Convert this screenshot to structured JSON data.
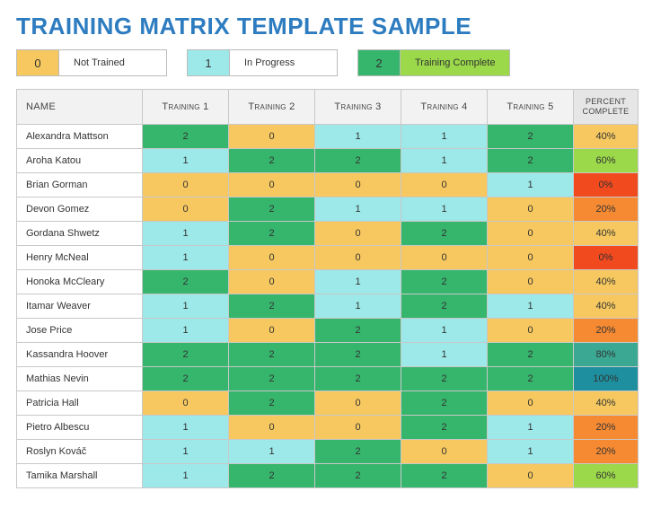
{
  "title": "TRAINING MATRIX TEMPLATE SAMPLE",
  "legend": [
    {
      "code": "0",
      "label": "Not Trained"
    },
    {
      "code": "1",
      "label": "In Progress"
    },
    {
      "code": "2",
      "label": "Training Complete"
    }
  ],
  "headers": {
    "name": "NAME",
    "trainings": [
      "Training 1",
      "Training 2",
      "Training 3",
      "Training 4",
      "Training 5"
    ],
    "percent": "PERCENT COMPLETE"
  },
  "percent_colors": {
    "0": "#f24a1f",
    "20": "#f58a33",
    "40": "#f6c85f",
    "60": "#9bd94a",
    "80": "#3aa893",
    "100": "#1d8f9e"
  },
  "rows": [
    {
      "name": "Alexandra Mattson",
      "t": [
        2,
        0,
        1,
        1,
        2
      ],
      "pct": "40%"
    },
    {
      "name": "Aroha Katou",
      "t": [
        1,
        2,
        2,
        1,
        2
      ],
      "pct": "60%"
    },
    {
      "name": "Brian Gorman",
      "t": [
        0,
        0,
        0,
        0,
        1
      ],
      "pct": "0%"
    },
    {
      "name": "Devon Gomez",
      "t": [
        0,
        2,
        1,
        1,
        0
      ],
      "pct": "20%"
    },
    {
      "name": "Gordana Shwetz",
      "t": [
        1,
        2,
        0,
        2,
        0
      ],
      "pct": "40%"
    },
    {
      "name": "Henry McNeal",
      "t": [
        1,
        0,
        0,
        0,
        0
      ],
      "pct": "0%"
    },
    {
      "name": "Honoka McCleary",
      "t": [
        2,
        0,
        1,
        2,
        0
      ],
      "pct": "40%"
    },
    {
      "name": "Itamar Weaver",
      "t": [
        1,
        2,
        1,
        2,
        1
      ],
      "pct": "40%"
    },
    {
      "name": "Jose Price",
      "t": [
        1,
        0,
        2,
        1,
        0
      ],
      "pct": "20%"
    },
    {
      "name": "Kassandra Hoover",
      "t": [
        2,
        2,
        2,
        1,
        2
      ],
      "pct": "80%"
    },
    {
      "name": "Mathias Nevin",
      "t": [
        2,
        2,
        2,
        2,
        2
      ],
      "pct": "100%"
    },
    {
      "name": "Patricia Hall",
      "t": [
        0,
        2,
        0,
        2,
        0
      ],
      "pct": "40%"
    },
    {
      "name": "Pietro Albescu",
      "t": [
        1,
        0,
        0,
        2,
        1
      ],
      "pct": "20%"
    },
    {
      "name": "Roslyn Kováč",
      "t": [
        1,
        1,
        2,
        0,
        1
      ],
      "pct": "20%"
    },
    {
      "name": "Tamika Marshall",
      "t": [
        1,
        2,
        2,
        2,
        0
      ],
      "pct": "60%"
    }
  ]
}
